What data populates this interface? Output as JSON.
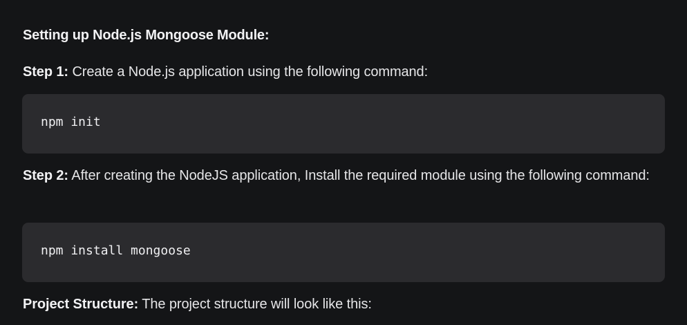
{
  "section": {
    "heading": "Setting up Node.js Mongoose Module:"
  },
  "steps": [
    {
      "lead": "Step 1:",
      "text": " Create a Node.js application using the following command:",
      "code": "npm init"
    },
    {
      "lead": "Step 2:",
      "text": " After creating the NodeJS application, Install the required module using the following command:",
      "code": "npm install mongoose"
    }
  ],
  "project_structure": {
    "lead": "Project Structure:",
    "text": " The project structure will look like this:"
  },
  "colors": {
    "background": "#141517",
    "code_background": "#2b2b2e",
    "text": "#e6e6e8"
  }
}
